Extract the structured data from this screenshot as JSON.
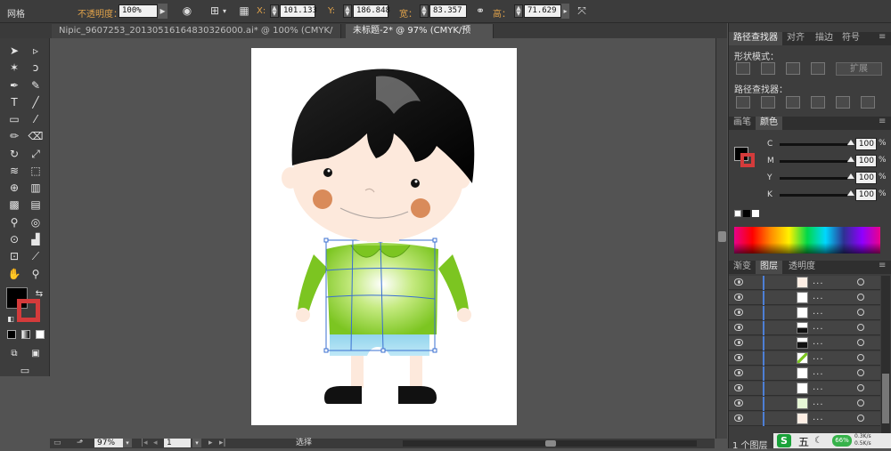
{
  "control_bar": {
    "title_label": "网格",
    "opacity_label": "不透明度：",
    "opacity_value": "100%",
    "x_label": "X:",
    "x_value": "101.133",
    "y_label": "Y:",
    "y_value": "186.848",
    "width_label": "宽：",
    "width_value": "83.357",
    "height_label": "高：",
    "height_value": "71.629"
  },
  "tabs": [
    {
      "label": "Nipic_9607253_20130516164830326000.ai* @ 100% (CMYK/预览)",
      "close": "×"
    },
    {
      "label": "未标题-2* @ 97% (CMYK/预览)",
      "close": "×"
    }
  ],
  "status": {
    "zoom": "97%",
    "page": "1",
    "mode": "选择"
  },
  "pathfinder_panel": {
    "tabs": [
      "路径查找器",
      "对齐",
      "描边",
      "符号"
    ],
    "shape_modes_label": "形状模式：",
    "expand_button": "扩展",
    "pathfinders_label": "路径查找器："
  },
  "color_panel": {
    "tabs": [
      "画笔",
      "颜色"
    ],
    "channels": [
      {
        "letter": "C",
        "value": "100",
        "unit": "%"
      },
      {
        "letter": "M",
        "value": "100",
        "unit": "%"
      },
      {
        "letter": "Y",
        "value": "100",
        "unit": "%"
      },
      {
        "letter": "K",
        "value": "100",
        "unit": "%"
      }
    ]
  },
  "layers_panel": {
    "tabs": [
      "渐变",
      "图层",
      "透明度"
    ],
    "row_dots": "...",
    "footer": "1 个图层"
  },
  "ime": {
    "brand": "S",
    "label": "五",
    "battery": "66%",
    "net_up": "0.3K/s",
    "net_down": "0.5K/s"
  },
  "colors": {
    "hair": "#1a1a1a",
    "skin": "#fde9dc",
    "shirt": "#7cc521",
    "shorts": "#8fd3ec",
    "cheek": "#d98b5a",
    "shoe": "#111111"
  }
}
